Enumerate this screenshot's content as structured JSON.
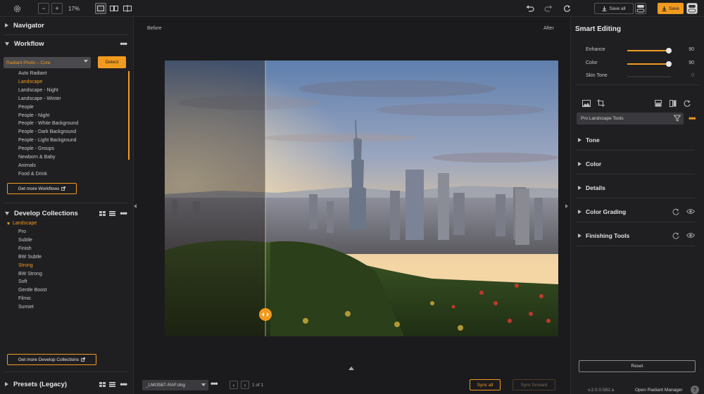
{
  "toolbar": {
    "zoom_minus": "−",
    "zoom_plus": "+",
    "zoom_level": "17%",
    "save_all_label": "Save all",
    "save_label": "Save"
  },
  "left_panel": {
    "navigator_title": "Navigator",
    "workflow_title": "Workflow",
    "workflow_select_value": "Radiant Photo – Core",
    "detect_label": "Detect",
    "workflow_items": [
      "Auto Radiant",
      "Landscape",
      "Landscape - Night",
      "Landscape - Winter",
      "People",
      "People - Night",
      "People - White Background",
      "People - Dark Background",
      "People - Light Background",
      "People - Groups",
      "Newborn & Baby",
      "Animals",
      "Food & Drink"
    ],
    "workflow_selected_index": 1,
    "get_more_workflows": "Get more Workflows",
    "develop_title": "Develop Collections",
    "develop_group": "Landscape",
    "develop_items": [
      "Pro",
      "Subtle",
      "Finish",
      "BW Subtle",
      "Strong",
      "BW Strong",
      "Soft",
      "Gentle Boost",
      "Filmic",
      "Sunset"
    ],
    "develop_selected_index": 4,
    "get_more_develop": "Get more Develop Collections",
    "presets_title": "Presets (Legacy)"
  },
  "center": {
    "before_label": "Before",
    "after_label": "After",
    "filename": "_LMI3587-RAF.dng",
    "page_indicator": "1 of 1",
    "sync_all": "Sync all",
    "sync_forward": "Sync forward"
  },
  "right_panel": {
    "title": "Smart Editing",
    "sliders": [
      {
        "label": "Enhance",
        "value": "90",
        "fraction": 0.9,
        "enabled": true
      },
      {
        "label": "Color",
        "value": "90",
        "fraction": 0.9,
        "enabled": true
      },
      {
        "label": "Skin Tone",
        "value": "0",
        "fraction": 0.0,
        "enabled": false
      }
    ],
    "tools_select_value": "Pro Landscape Tools",
    "sections": [
      "Tone",
      "Color",
      "Details",
      "Color Grading",
      "Finishing Tools"
    ],
    "reset_label": "Reset",
    "version": "v.2.0.0.582.a",
    "open_manager": "Open Radiant Manager"
  },
  "colors": {
    "accent": "#f29a1f",
    "panel_bg": "#1f1f22",
    "canvas_bg": "#1b1b1e"
  }
}
